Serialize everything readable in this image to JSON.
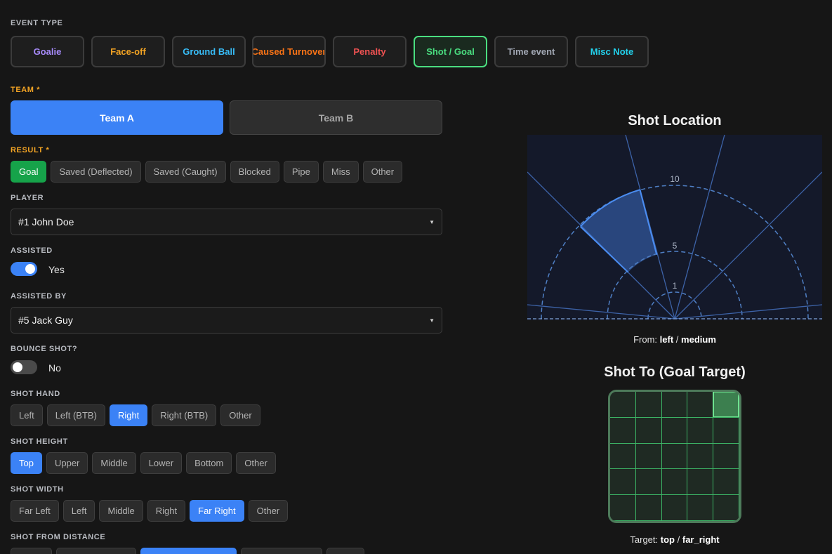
{
  "event_type": {
    "label": "EVENT TYPE",
    "items": [
      {
        "label": "Goalie",
        "color": "#a78bfa"
      },
      {
        "label": "Face-off",
        "color": "#f5a524"
      },
      {
        "label": "Ground Ball",
        "color": "#38bdf8"
      },
      {
        "label": "Caused Turnover",
        "color": "#f97316"
      },
      {
        "label": "Penalty",
        "color": "#f05252"
      },
      {
        "label": "Shot / Goal",
        "color": "#4ade80",
        "active": true
      },
      {
        "label": "Time event",
        "color": "#a1a7b3"
      },
      {
        "label": "Misc Note",
        "color": "#22d3ee"
      }
    ]
  },
  "team": {
    "label": "TEAM *",
    "a": "Team A",
    "b": "Team B",
    "selected": "Team A"
  },
  "result": {
    "label": "RESULT *",
    "options": [
      "Goal",
      "Saved (Deflected)",
      "Saved (Caught)",
      "Blocked",
      "Pipe",
      "Miss",
      "Other"
    ],
    "selected": "Goal"
  },
  "player": {
    "label": "PLAYER",
    "value": "#1 John Doe",
    "caret": "▼"
  },
  "assisted": {
    "label": "ASSISTED",
    "value": "Yes",
    "on": true
  },
  "assisted_by": {
    "label": "ASSISTED BY",
    "value": "#5 Jack Guy",
    "caret": "▼"
  },
  "bounce_shot": {
    "label": "BOUNCE SHOT?",
    "value": "No",
    "on": false
  },
  "shot_hand": {
    "label": "SHOT HAND",
    "options": [
      "Left",
      "Left (BTB)",
      "Right",
      "Right (BTB)",
      "Other"
    ],
    "selected": "Right"
  },
  "shot_height": {
    "label": "SHOT HEIGHT",
    "options": [
      "Top",
      "Upper",
      "Middle",
      "Lower",
      "Bottom",
      "Other"
    ],
    "selected": "Top"
  },
  "shot_width": {
    "label": "SHOT WIDTH",
    "options": [
      "Far Left",
      "Left",
      "Middle",
      "Right",
      "Far Right",
      "Other"
    ],
    "selected": "Far Right"
  },
  "shot_distance": {
    "label": "SHOT FROM DISTANCE"
  },
  "shot_location": {
    "title": "Shot Location",
    "ring_labels": [
      "10",
      "5",
      "1"
    ],
    "from_label": "From:",
    "from_angle": "left",
    "sep": "/",
    "from_distance": "medium"
  },
  "shot_to": {
    "title": "Shot To (Goal Target)",
    "target_label": "Target:",
    "target_height": "top",
    "sep": "/",
    "target_width": "far_right",
    "grid_rows": 5,
    "grid_cols": 5,
    "selected_row": 0,
    "selected_col": 4
  },
  "colors": {
    "accent": "#3b82f6",
    "success": "#16a34a",
    "required": "#f5a524",
    "field": "#14192a",
    "goal_line": "#3cb465"
  }
}
